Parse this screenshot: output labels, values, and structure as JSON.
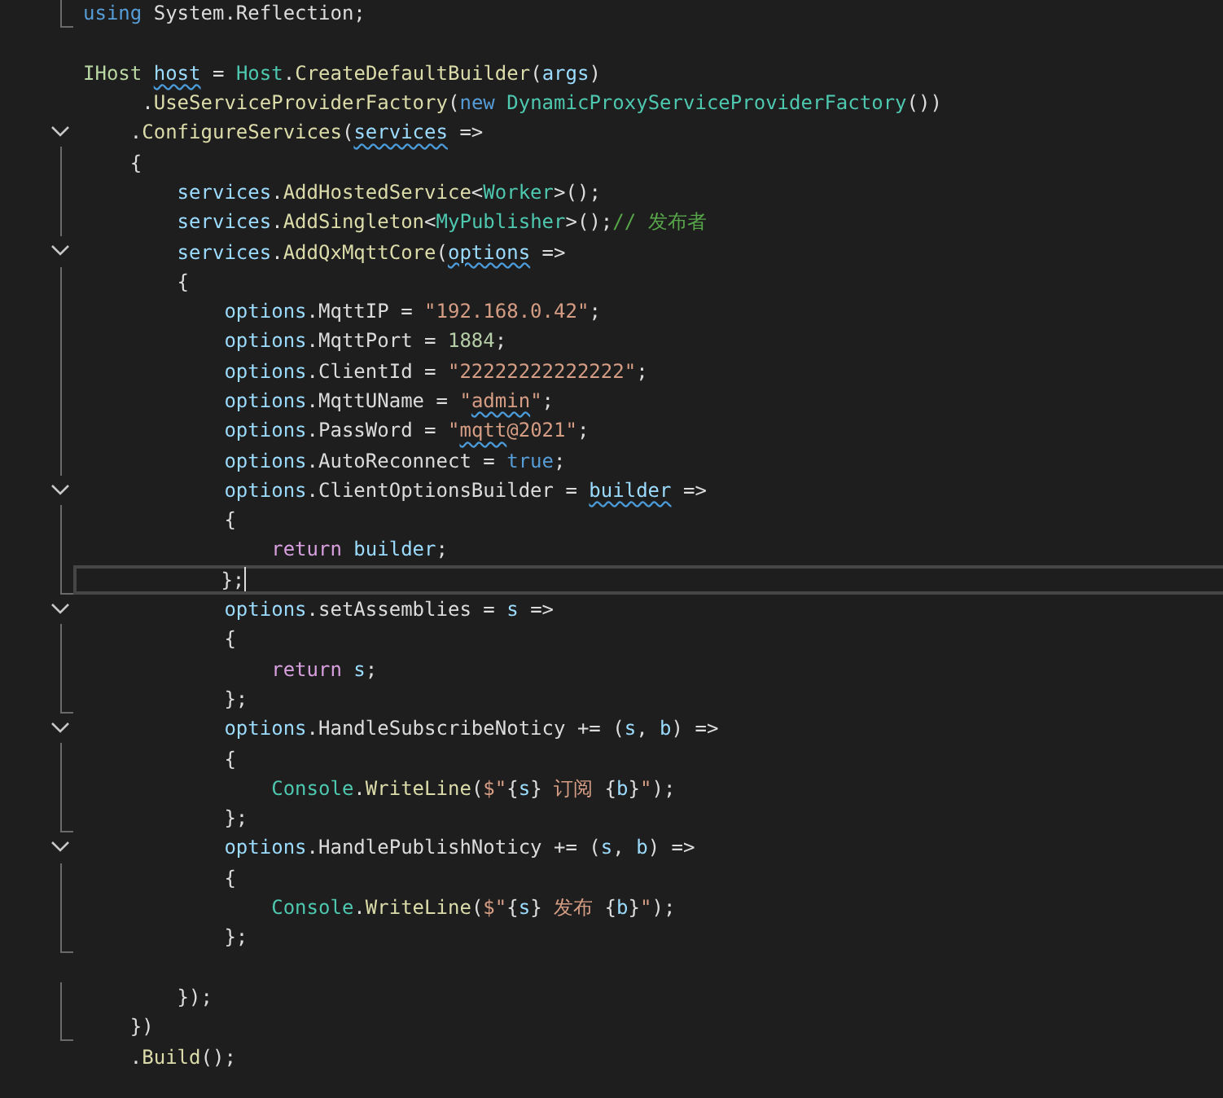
{
  "editor": {
    "lines": [
      {
        "kind": "end",
        "current": false,
        "tokens": [
          {
            "kind": "keyword",
            "text": "using"
          },
          {
            "kind": "plain",
            "text": " System.Reflection;"
          }
        ]
      },
      {
        "kind": "none",
        "current": false
      },
      {
        "kind": "none",
        "current": false,
        "tokens": [
          {
            "kind": "interface",
            "text": "IHost "
          },
          {
            "kind": "local",
            "text": "host",
            "squiggle": true
          },
          {
            "kind": "plain",
            "text": " = "
          },
          {
            "kind": "type",
            "text": "Host"
          },
          {
            "kind": "plain",
            "text": "."
          },
          {
            "kind": "method",
            "text": "CreateDefaultBuilder"
          },
          {
            "kind": "plain",
            "text": "("
          },
          {
            "kind": "local",
            "text": "args"
          },
          {
            "kind": "plain",
            "text": ")"
          }
        ]
      },
      {
        "kind": "none",
        "current": false,
        "tokens": [
          {
            "kind": "plain",
            "text": "     ."
          },
          {
            "kind": "method",
            "text": "UseServiceProviderFactory"
          },
          {
            "kind": "plain",
            "text": "("
          },
          {
            "kind": "keyword",
            "text": "new "
          },
          {
            "kind": "type",
            "text": "DynamicProxyServiceProviderFactory"
          },
          {
            "kind": "plain",
            "text": "())"
          }
        ]
      },
      {
        "kind": "start",
        "current": false,
        "tokens": [
          {
            "kind": "plain",
            "text": "    ."
          },
          {
            "kind": "method",
            "text": "ConfigureServices"
          },
          {
            "kind": "plain",
            "text": "("
          },
          {
            "kind": "local",
            "text": "services",
            "squiggle": true
          },
          {
            "kind": "plain",
            "text": " =>"
          }
        ]
      },
      {
        "kind": "line",
        "current": false,
        "tokens": [
          {
            "kind": "plain",
            "text": "    {"
          }
        ]
      },
      {
        "kind": "line",
        "current": false,
        "tokens": [
          {
            "kind": "local",
            "text": "        services"
          },
          {
            "kind": "plain",
            "text": "."
          },
          {
            "kind": "method",
            "text": "AddHostedService"
          },
          {
            "kind": "plain",
            "text": "<"
          },
          {
            "kind": "type",
            "text": "Worker"
          },
          {
            "kind": "plain",
            "text": ">();"
          }
        ]
      },
      {
        "kind": "line",
        "current": false,
        "tokens": [
          {
            "kind": "local",
            "text": "        services"
          },
          {
            "kind": "plain",
            "text": "."
          },
          {
            "kind": "method",
            "text": "AddSingleton"
          },
          {
            "kind": "plain",
            "text": "<"
          },
          {
            "kind": "type",
            "text": "MyPublisher"
          },
          {
            "kind": "plain",
            "text": ">();"
          },
          {
            "kind": "comment",
            "text": "// 发布者"
          }
        ]
      },
      {
        "kind": "start",
        "current": false,
        "tokens": [
          {
            "kind": "local",
            "text": "        services"
          },
          {
            "kind": "plain",
            "text": "."
          },
          {
            "kind": "method",
            "text": "AddQxMqttCore"
          },
          {
            "kind": "plain",
            "text": "("
          },
          {
            "kind": "local",
            "text": "options",
            "squiggle": true
          },
          {
            "kind": "plain",
            "text": " =>"
          }
        ]
      },
      {
        "kind": "line",
        "current": false,
        "tokens": [
          {
            "kind": "plain",
            "text": "        {"
          }
        ]
      },
      {
        "kind": "line",
        "current": false,
        "tokens": [
          {
            "kind": "local",
            "text": "            options"
          },
          {
            "kind": "plain",
            "text": ".MqttIP = "
          },
          {
            "kind": "string",
            "text": "\"192.168.0.42\""
          },
          {
            "kind": "plain",
            "text": ";"
          }
        ]
      },
      {
        "kind": "line",
        "current": false,
        "tokens": [
          {
            "kind": "local",
            "text": "            options"
          },
          {
            "kind": "plain",
            "text": ".MqttPort = "
          },
          {
            "kind": "number",
            "text": "1884"
          },
          {
            "kind": "plain",
            "text": ";"
          }
        ]
      },
      {
        "kind": "line",
        "current": false,
        "tokens": [
          {
            "kind": "local",
            "text": "            options"
          },
          {
            "kind": "plain",
            "text": ".ClientId = "
          },
          {
            "kind": "string",
            "text": "\"22222222222222\""
          },
          {
            "kind": "plain",
            "text": ";"
          }
        ]
      },
      {
        "kind": "line",
        "current": false,
        "tokens": [
          {
            "kind": "local",
            "text": "            options"
          },
          {
            "kind": "plain",
            "text": ".MqttUName = "
          },
          {
            "kind": "string",
            "text": "\""
          },
          {
            "kind": "string",
            "text": "admin",
            "squiggle": true
          },
          {
            "kind": "string",
            "text": "\""
          },
          {
            "kind": "plain",
            "text": ";"
          }
        ]
      },
      {
        "kind": "line",
        "current": false,
        "tokens": [
          {
            "kind": "local",
            "text": "            options"
          },
          {
            "kind": "plain",
            "text": ".PassWord = "
          },
          {
            "kind": "string",
            "text": "\""
          },
          {
            "kind": "string",
            "text": "mqtt",
            "squiggle": true
          },
          {
            "kind": "string",
            "text": "@2021\""
          },
          {
            "kind": "plain",
            "text": ";"
          }
        ]
      },
      {
        "kind": "line",
        "current": false,
        "tokens": [
          {
            "kind": "local",
            "text": "            options"
          },
          {
            "kind": "plain",
            "text": ".AutoReconnect = "
          },
          {
            "kind": "keyword",
            "text": "true"
          },
          {
            "kind": "plain",
            "text": ";"
          }
        ]
      },
      {
        "kind": "start",
        "current": false,
        "tokens": [
          {
            "kind": "local",
            "text": "            options"
          },
          {
            "kind": "plain",
            "text": ".ClientOptionsBuilder = "
          },
          {
            "kind": "local",
            "text": "builder",
            "squiggle": true
          },
          {
            "kind": "plain",
            "text": " =>"
          }
        ]
      },
      {
        "kind": "line",
        "current": false,
        "tokens": [
          {
            "kind": "plain",
            "text": "            {"
          }
        ]
      },
      {
        "kind": "line",
        "current": false,
        "tokens": [
          {
            "kind": "control",
            "text": "                return"
          },
          {
            "kind": "local",
            "text": " builder"
          },
          {
            "kind": "plain",
            "text": ";"
          }
        ]
      },
      {
        "kind": "end",
        "current": true,
        "tokens": [
          {
            "kind": "plain",
            "text": "            };"
          }
        ]
      },
      {
        "kind": "start",
        "current": false,
        "tokens": [
          {
            "kind": "local",
            "text": "            options"
          },
          {
            "kind": "plain",
            "text": ".setAssemblies = "
          },
          {
            "kind": "local",
            "text": "s"
          },
          {
            "kind": "plain",
            "text": " =>"
          }
        ]
      },
      {
        "kind": "line",
        "current": false,
        "tokens": [
          {
            "kind": "plain",
            "text": "            {"
          }
        ]
      },
      {
        "kind": "line",
        "current": false,
        "tokens": [
          {
            "kind": "control",
            "text": "                return"
          },
          {
            "kind": "local",
            "text": " s"
          },
          {
            "kind": "plain",
            "text": ";"
          }
        ]
      },
      {
        "kind": "end",
        "current": false,
        "tokens": [
          {
            "kind": "plain",
            "text": "            };"
          }
        ]
      },
      {
        "kind": "start",
        "current": false,
        "tokens": [
          {
            "kind": "local",
            "text": "            options"
          },
          {
            "kind": "plain",
            "text": ".HandleSubscribeNoticy += ("
          },
          {
            "kind": "local",
            "text": "s"
          },
          {
            "kind": "plain",
            "text": ", "
          },
          {
            "kind": "local",
            "text": "b"
          },
          {
            "kind": "plain",
            "text": ") =>"
          }
        ]
      },
      {
        "kind": "line",
        "current": false,
        "tokens": [
          {
            "kind": "plain",
            "text": "            {"
          }
        ]
      },
      {
        "kind": "line",
        "current": false,
        "tokens": [
          {
            "kind": "type",
            "text": "                Console"
          },
          {
            "kind": "plain",
            "text": "."
          },
          {
            "kind": "method",
            "text": "WriteLine"
          },
          {
            "kind": "plain",
            "text": "("
          },
          {
            "kind": "string",
            "text": "$\""
          },
          {
            "kind": "plain",
            "text": "{"
          },
          {
            "kind": "local",
            "text": "s"
          },
          {
            "kind": "plain",
            "text": "}"
          },
          {
            "kind": "string",
            "text": " 订阅 "
          },
          {
            "kind": "plain",
            "text": "{"
          },
          {
            "kind": "local",
            "text": "b"
          },
          {
            "kind": "plain",
            "text": "}"
          },
          {
            "kind": "string",
            "text": "\""
          },
          {
            "kind": "plain",
            "text": ");"
          }
        ]
      },
      {
        "kind": "end",
        "current": false,
        "tokens": [
          {
            "kind": "plain",
            "text": "            };"
          }
        ]
      },
      {
        "kind": "start",
        "current": false,
        "tokens": [
          {
            "kind": "local",
            "text": "            options"
          },
          {
            "kind": "plain",
            "text": ".HandlePublishNoticy += ("
          },
          {
            "kind": "local",
            "text": "s"
          },
          {
            "kind": "plain",
            "text": ", "
          },
          {
            "kind": "local",
            "text": "b"
          },
          {
            "kind": "plain",
            "text": ") =>"
          }
        ]
      },
      {
        "kind": "line",
        "current": false,
        "tokens": [
          {
            "kind": "plain",
            "text": "            {"
          }
        ]
      },
      {
        "kind": "line",
        "current": false,
        "tokens": [
          {
            "kind": "type",
            "text": "                Console"
          },
          {
            "kind": "plain",
            "text": "."
          },
          {
            "kind": "method",
            "text": "WriteLine"
          },
          {
            "kind": "plain",
            "text": "("
          },
          {
            "kind": "string",
            "text": "$\""
          },
          {
            "kind": "plain",
            "text": "{"
          },
          {
            "kind": "local",
            "text": "s"
          },
          {
            "kind": "plain",
            "text": "}"
          },
          {
            "kind": "string",
            "text": " 发布 "
          },
          {
            "kind": "plain",
            "text": "{"
          },
          {
            "kind": "local",
            "text": "b"
          },
          {
            "kind": "plain",
            "text": "}"
          },
          {
            "kind": "string",
            "text": "\""
          },
          {
            "kind": "plain",
            "text": ");"
          }
        ]
      },
      {
        "kind": "end",
        "current": false,
        "tokens": [
          {
            "kind": "plain",
            "text": "            };"
          }
        ]
      },
      {
        "kind": "none",
        "current": false
      },
      {
        "kind": "line",
        "current": false,
        "tokens": [
          {
            "kind": "plain",
            "text": "        });"
          }
        ]
      },
      {
        "kind": "end",
        "current": false,
        "tokens": [
          {
            "kind": "plain",
            "text": "    })"
          }
        ]
      },
      {
        "kind": "none",
        "current": false,
        "tokens": [
          {
            "kind": "plain",
            "text": "    ."
          },
          {
            "kind": "method",
            "text": "Build"
          },
          {
            "kind": "plain",
            "text": "();"
          }
        ]
      }
    ]
  }
}
